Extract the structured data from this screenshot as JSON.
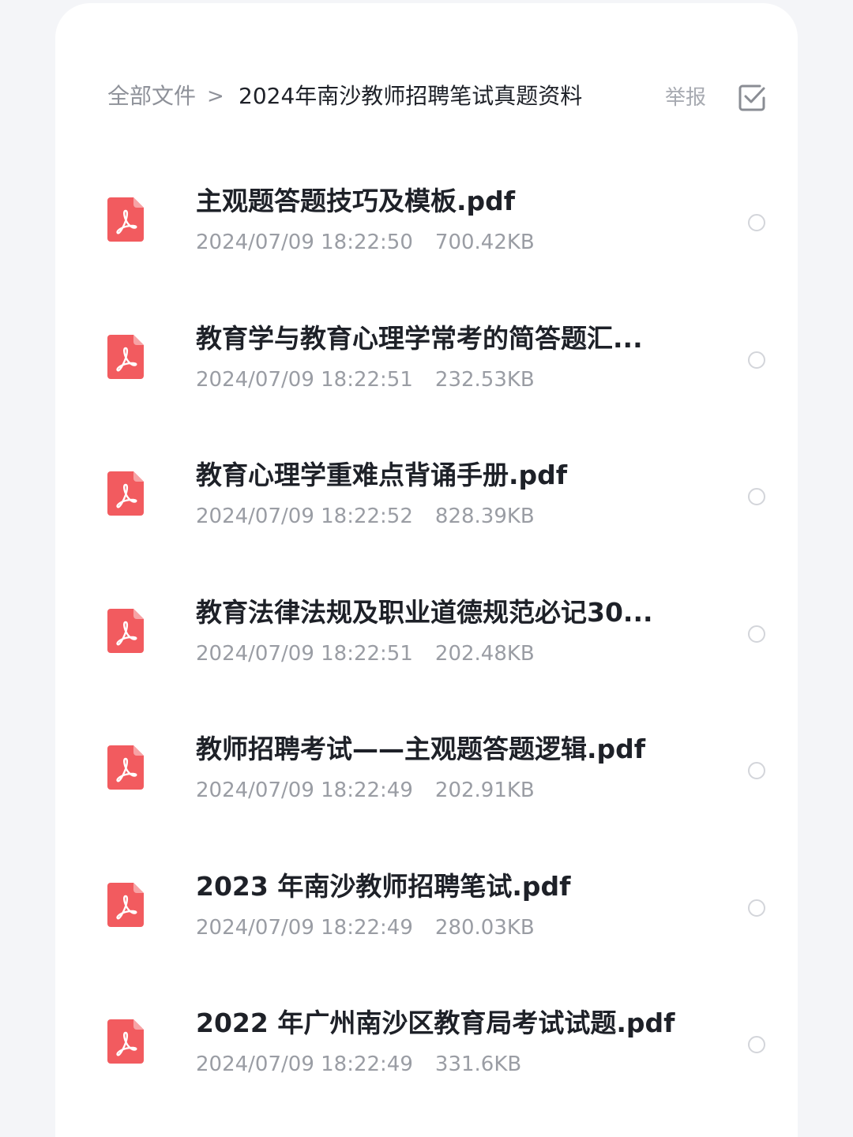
{
  "header": {
    "breadcrumb_root": "全部文件",
    "breadcrumb_separator": ">",
    "breadcrumb_current": "2024年南沙教师招聘笔试真题资料",
    "report_label": "举报",
    "multi_select_icon": "checkbox-check-icon"
  },
  "colors": {
    "pdf_icon": "#f25b5f",
    "title_text": "#1e2128",
    "meta_text": "#9a9da4"
  },
  "files": [
    {
      "name": "主观题答题技巧及模板.pdf",
      "date": "2024/07/09 18:22:50",
      "size": "700.42KB",
      "icon": "pdf-icon"
    },
    {
      "name": "教育学与教育心理学常考的简答题汇...",
      "date": "2024/07/09 18:22:51",
      "size": "232.53KB",
      "icon": "pdf-icon"
    },
    {
      "name": "教育心理学重难点背诵手册.pdf",
      "date": "2024/07/09 18:22:52",
      "size": "828.39KB",
      "icon": "pdf-icon"
    },
    {
      "name": "教育法律法规及职业道德规范必记30...",
      "date": "2024/07/09 18:22:51",
      "size": "202.48KB",
      "icon": "pdf-icon"
    },
    {
      "name": "教师招聘考试——主观题答题逻辑.pdf",
      "date": "2024/07/09 18:22:49",
      "size": "202.91KB",
      "icon": "pdf-icon"
    },
    {
      "name": "2023 年南沙教师招聘笔试.pdf",
      "date": "2024/07/09 18:22:49",
      "size": "280.03KB",
      "icon": "pdf-icon"
    },
    {
      "name": "2022 年广州南沙区教育局考试试题.pdf",
      "date": "2024/07/09 18:22:49",
      "size": "331.6KB",
      "icon": "pdf-icon"
    }
  ]
}
